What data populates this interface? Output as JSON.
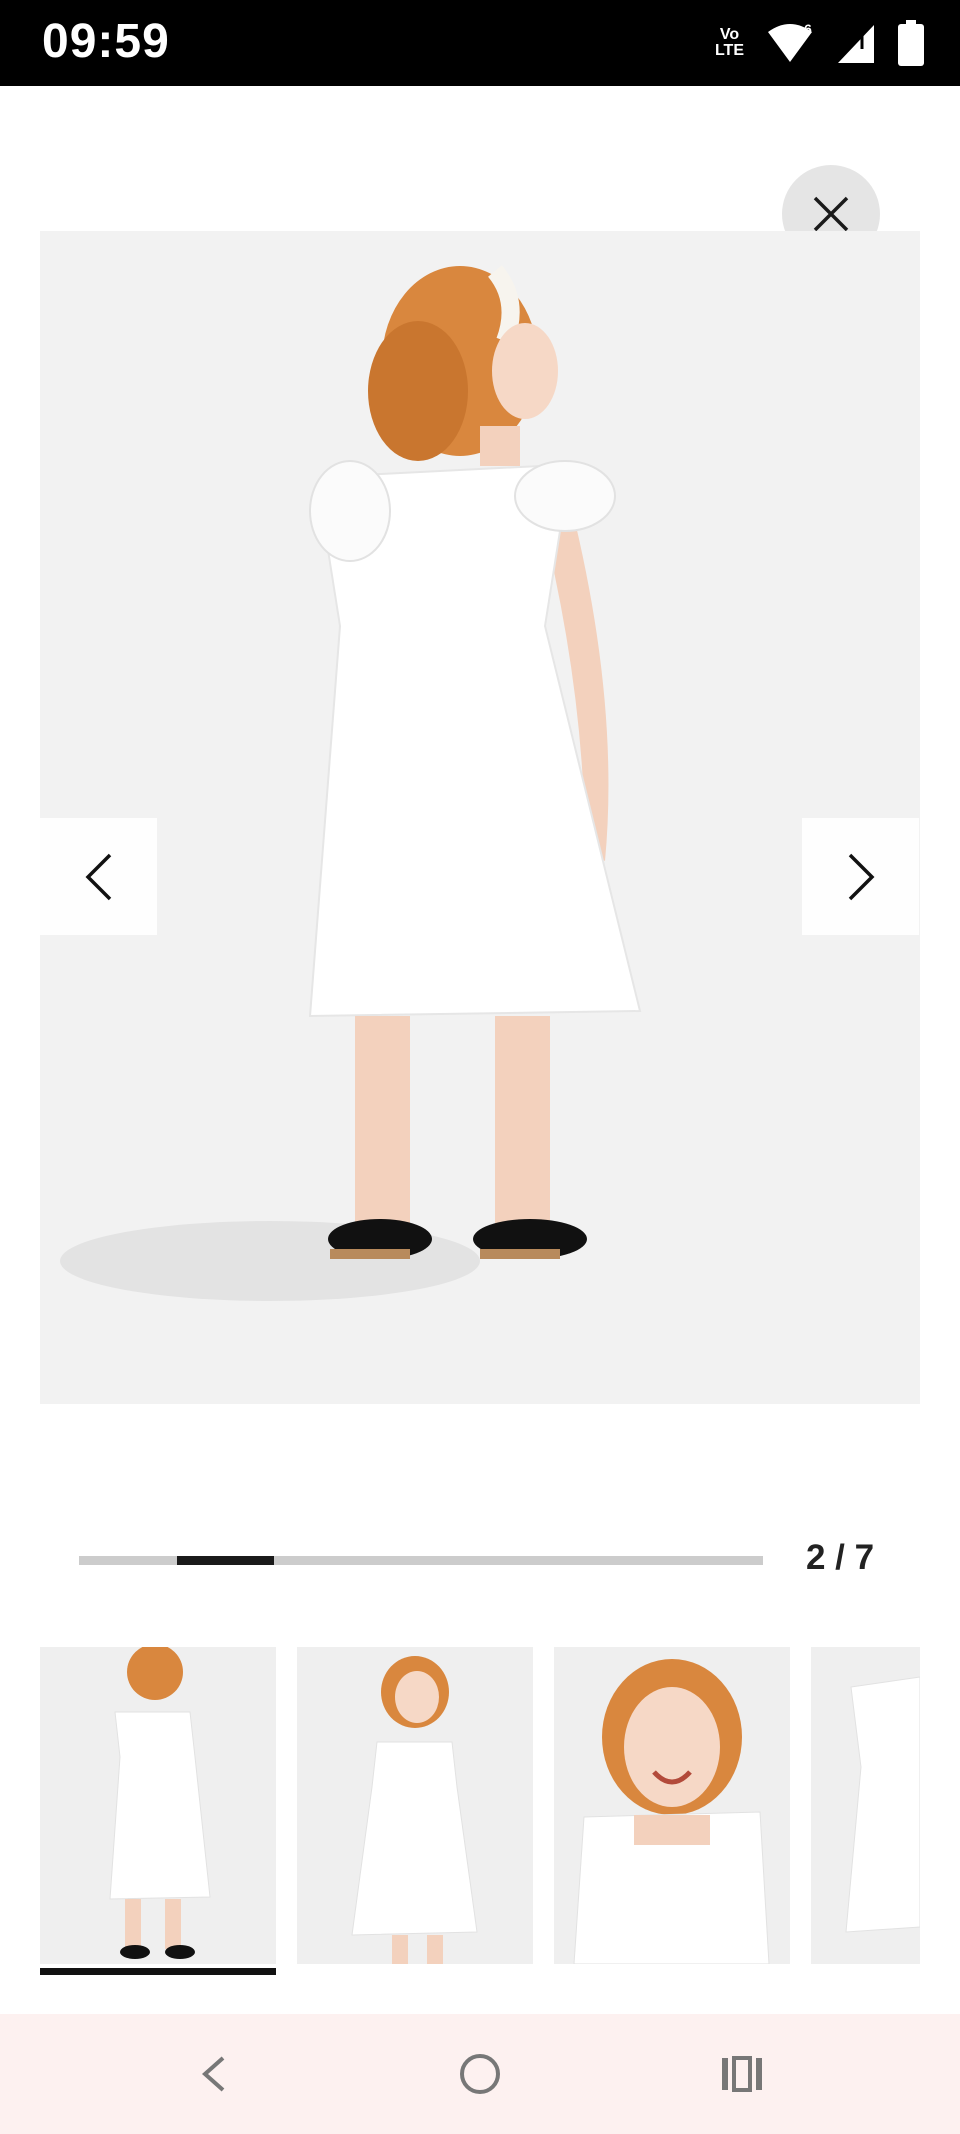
{
  "status_bar": {
    "time": "09:59",
    "volte_line1": "Vo",
    "volte_line2": "LTE",
    "signal_label": "6",
    "icons": [
      "volte-icon",
      "wifi-icon",
      "cell-signal-icon",
      "battery-icon"
    ]
  },
  "viewer": {
    "close_icon": "close-icon",
    "prev_icon": "chevron-left-icon",
    "next_icon": "chevron-right-icon",
    "counter": "2 / 7",
    "current_index": 2,
    "total": 7
  },
  "thumbnails": [
    {
      "view": "back",
      "selected": true
    },
    {
      "view": "side",
      "selected": false
    },
    {
      "view": "front-closeup",
      "selected": false
    },
    {
      "view": "detail",
      "selected": false
    }
  ],
  "nav_bar": {
    "icons": [
      "back-icon",
      "home-icon",
      "recents-icon"
    ]
  },
  "colors": {
    "status_bar_bg": "#000000",
    "image_bg": "#f2f2f2",
    "progress_track": "#cccccc",
    "progress_fill": "#1a1a1a",
    "nav_bar_bg": "#fdf1f0"
  }
}
